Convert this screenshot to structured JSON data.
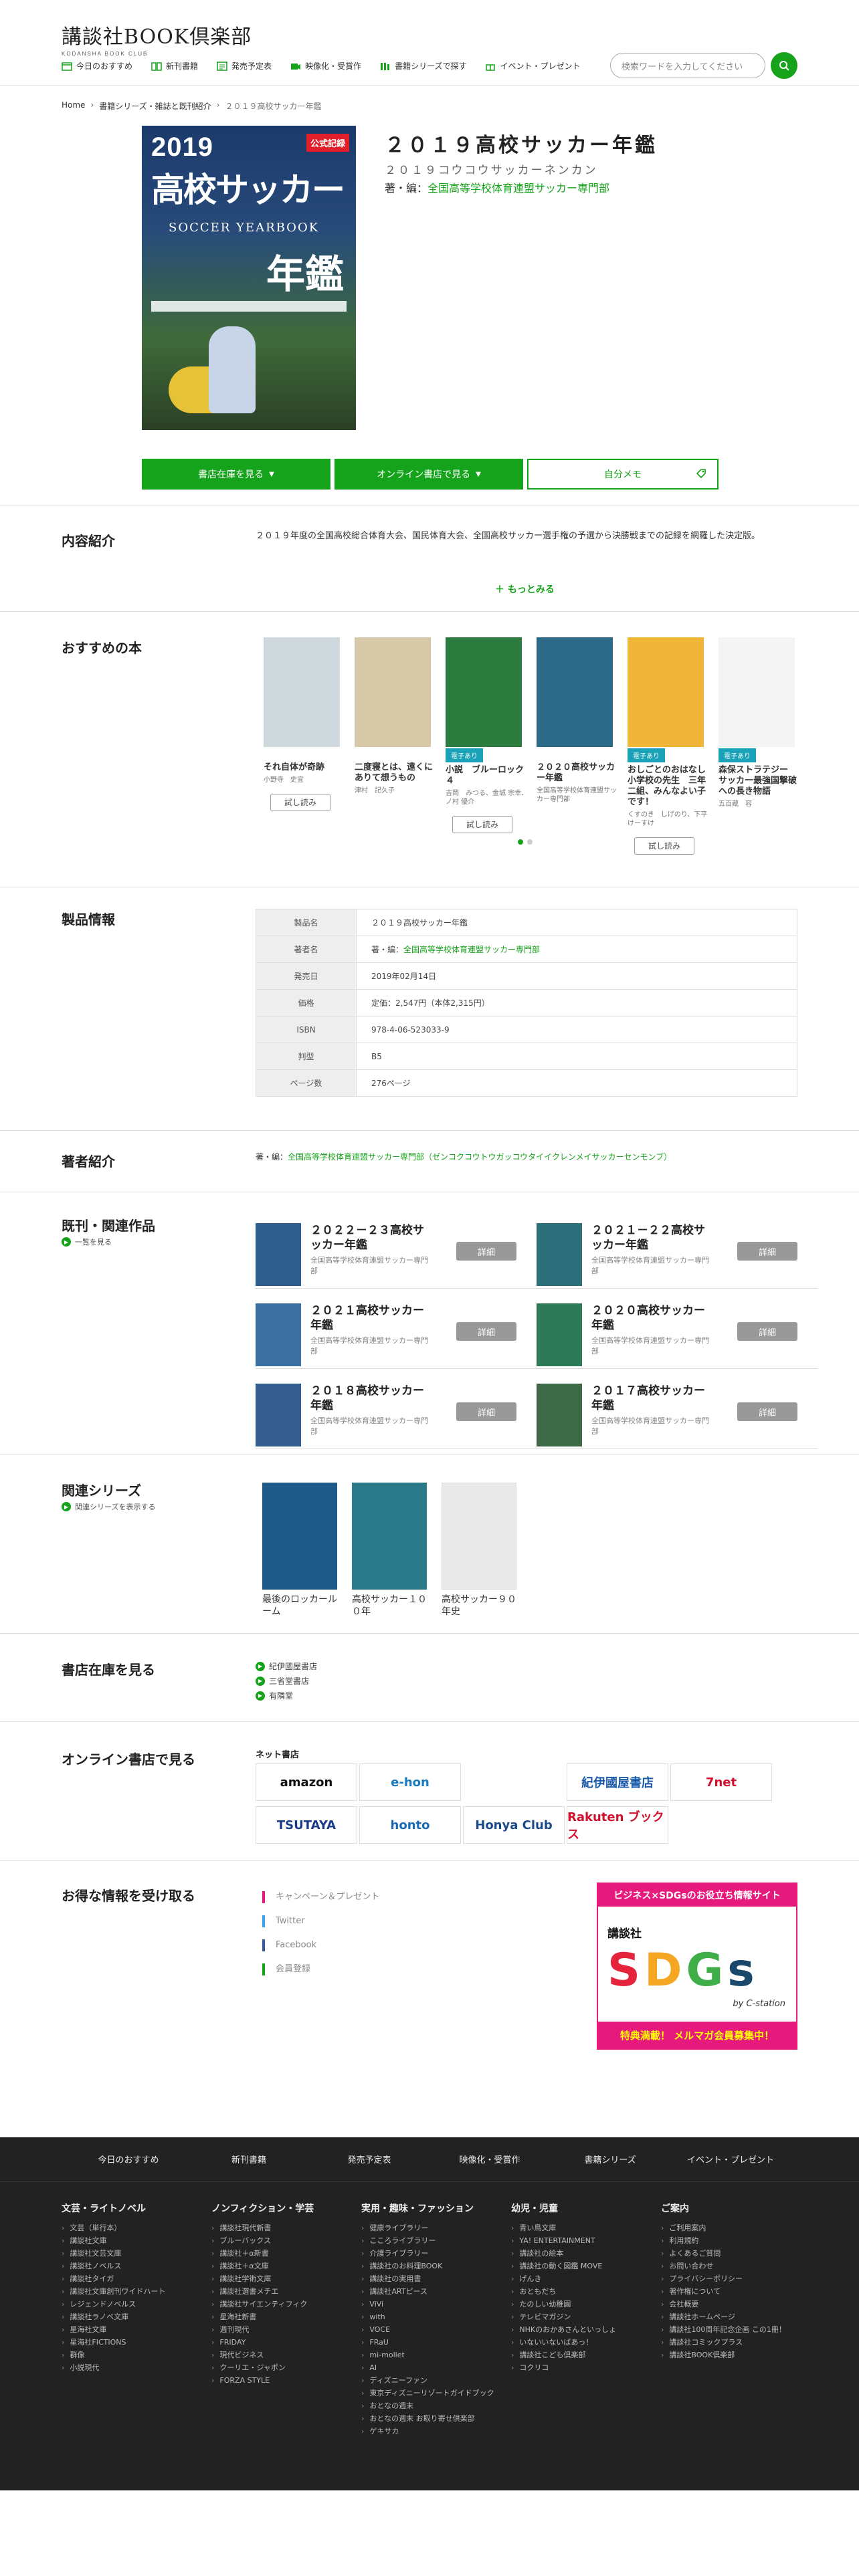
{
  "header": {
    "logo": "講談社BOOK倶楽部",
    "logo_sub": "KODANSHA BOOK CLUB",
    "nav": [
      "今日のおすすめ",
      "新刊書籍",
      "発売予定表",
      "映像化・受賞作",
      "書籍シリーズで探す",
      "イベント・プレゼント"
    ],
    "search_placeholder": "検索ワードを入力してください"
  },
  "breadcrumb": [
    "Home",
    "書籍シリーズ・雑誌と既刊紹介",
    "２０１９高校サッカー年鑑"
  ],
  "product": {
    "cover": {
      "year": "2019",
      "badge": "公式記録",
      "title1": "高校サッカー",
      "sub": "SOCCER YEARBOOK",
      "title2": "年鑑"
    },
    "title": "２０１９高校サッカー年鑑",
    "kana": "２０１９コウコウサッカーネンカン",
    "author_label": "著・編：",
    "author": "全国高等学校体育連盟サッカー専門部",
    "buttons": [
      "書店在庫を見る",
      "オンライン書店で見る",
      "自分メモ"
    ]
  },
  "intro": {
    "heading": "内容紹介",
    "text": "２０１９年度の全国高校総合体育大会、国民体育大会、全国高校サッカー選手権の予選から決勝戦までの記録を網羅した決定版。",
    "more": "＋ もっとみる"
  },
  "recommend": {
    "heading": "おすすめの本",
    "books": [
      {
        "name": "それ自体が奇跡",
        "author": "小野寺　史宜",
        "tag": "",
        "try": "試し読み",
        "color": "#cfd8dc"
      },
      {
        "name": "二度寝とは、遠くにありて想うもの",
        "author": "津村　記久子",
        "tag": "",
        "try": "",
        "color": "#d7c9a8"
      },
      {
        "name": "小説　ブルーロック　４",
        "author": "吉岡　みつる、金城 宗幸、ノ村 優介",
        "tag": "電子あり",
        "try": "試し読み",
        "color": "#2c7b3f"
      },
      {
        "name": "２０２０高校サッカー年鑑",
        "author": "全国高等学校体育連盟サッカー専門部",
        "tag": "",
        "try": "",
        "color": "#2d6a8a"
      },
      {
        "name": "おしごとのおはなし　小学校の先生　三年二組、みんなよい子です！",
        "author": "くすのき　しげのり、下平　けーすけ",
        "tag": "電子あり",
        "try": "試し読み",
        "color": "#f0b63a"
      },
      {
        "name": "森保ストラテジー　サッカー最強国撃破への長き物語",
        "author": "五百蔵　容",
        "tag": "電子あり",
        "try": "",
        "color": "#f4f4f4"
      }
    ]
  },
  "specs": {
    "heading": "製品情報",
    "rows": [
      {
        "k": "製品名",
        "v": "２０１９高校サッカー年鑑"
      },
      {
        "k": "著者名",
        "v": "著・編：",
        "link": "全国高等学校体育連盟サッカー専門部"
      },
      {
        "k": "発売日",
        "v": "2019年02月14日"
      },
      {
        "k": "価格",
        "v": "定価：2,547円（本体2,315円）"
      },
      {
        "k": "ISBN",
        "v": "978-4-06-523033-9"
      },
      {
        "k": "判型",
        "v": "B5"
      },
      {
        "k": "ページ数",
        "v": "276ページ"
      }
    ]
  },
  "author_sec": {
    "heading": "著者紹介",
    "label": "著・編：",
    "text": "全国高等学校体育連盟サッカー専門部（ゼンコクコウトウガッコウタイイクレンメイサッカーセンモンブ）"
  },
  "related": {
    "heading": "既刊・関連作品",
    "sub": "一覧を見る",
    "items": [
      {
        "name": "２０２２－２３高校サッカー年鑑",
        "author": "全国高等学校体育連盟サッカー専門部",
        "btn": "詳細"
      },
      {
        "name": "２０２１－２２高校サッカー年鑑",
        "author": "全国高等学校体育連盟サッカー専門部",
        "btn": "詳細"
      },
      {
        "name": "２０２１高校サッカー年鑑",
        "author": "全国高等学校体育連盟サッカー専門部",
        "btn": "詳細"
      },
      {
        "name": "２０２０高校サッカー年鑑",
        "author": "全国高等学校体育連盟サッカー専門部",
        "btn": "詳細"
      },
      {
        "name": "２０１８高校サッカー年鑑",
        "author": "全国高等学校体育連盟サッカー専門部",
        "btn": "詳細"
      },
      {
        "name": "２０１７高校サッカー年鑑",
        "author": "全国高等学校体育連盟サッカー専門部",
        "btn": "詳細"
      }
    ]
  },
  "series": {
    "heading": "関連シリーズ",
    "sub": "関連シリーズを表示する",
    "items": [
      {
        "name": "最後のロッカールーム",
        "color": "#1f5b8a"
      },
      {
        "name": "高校サッカー１００年",
        "color": "#2a7a8a"
      },
      {
        "name": "高校サッカー９０年史",
        "color": "#e9e9e9"
      }
    ]
  },
  "stock": {
    "heading": "書店在庫を見る",
    "stores": [
      "紀伊國屋書店",
      "三省堂書店",
      "有隣堂"
    ]
  },
  "online": {
    "heading": "オンライン書店で見る",
    "net": "ネット書店",
    "logos": [
      "amazon",
      "e-hon",
      "",
      "紀伊國屋書店",
      "7net",
      "TSUTAYA",
      "honto",
      "Honya Club",
      "Rakuten ブックス",
      ""
    ]
  },
  "info": {
    "heading": "お得な情報を受け取る",
    "links": [
      "キャンペーン＆プレゼント",
      "Twitter",
      "Facebook",
      "会員登録"
    ],
    "banner_top": "ビジネス×SDGsのお役立ち情報サイト",
    "banner_brand": "講談社",
    "banner_main": "SDGs",
    "banner_by": "by C-station",
    "banner_bottom": "特典満載！ メルマガ会員募集中！"
  },
  "footer": {
    "nav": [
      "今日のおすすめ",
      "新刊書籍",
      "発売予定表",
      "映像化・受賞作",
      "書籍シリーズ",
      "イベント・プレゼント"
    ],
    "cols": [
      {
        "h": "文芸・ライトノベル",
        "items": [
          "文芸（単行本）",
          "講談社文庫",
          "講談社文芸文庫",
          "講談社ノベルス",
          "講談社タイガ",
          "講談社文庫創刊ワイドハート",
          "レジェンドノベルス",
          "講談社ラノベ文庫",
          "星海社文庫",
          "星海社FICTIONS",
          "群像",
          "小説現代"
        ]
      },
      {
        "h": "ノンフィクション・学芸",
        "items": [
          "講談社現代新書",
          "ブルーバックス",
          "講談社＋α新書",
          "講談社＋α文庫",
          "講談社学術文庫",
          "講談社選書メチエ",
          "講談社サイエンティフィク",
          "星海社新書",
          "週刊現代",
          "FRIDAY",
          "現代ビジネス",
          "クーリエ・ジャポン",
          "FORZA STYLE"
        ]
      },
      {
        "h": "実用・趣味・ファッション",
        "items": [
          "健康ライブラリー",
          "こころライブラリー",
          "介護ライブラリー",
          "講談社のお料理BOOK",
          "講談社の実用書",
          "講談社ARTピース",
          "ViVi",
          "with",
          "VOCE",
          "FRaU",
          "mi-mollet",
          "AI",
          "ディズニーファン",
          "東京ディズニーリゾートガイドブック",
          "おとなの週末",
          "おとなの週末 お取り寄せ倶楽部",
          "ゲキサカ"
        ]
      },
      {
        "h": "幼児・児童",
        "items": [
          "青い鳥文庫",
          "YA! ENTERTAINMENT",
          "講談社の絵本",
          "講談社の動く図鑑 MOVE",
          "げんき",
          "おともだち",
          "たのしい幼稚園",
          "テレビマガジン",
          "NHKのおかあさんといっしょ",
          "いないいないばあっ！",
          "講談社こども倶楽部",
          "コクリコ"
        ]
      },
      {
        "h": "ご案内",
        "items": [
          "ご利用案内",
          "利用規約",
          "よくあるご質問",
          "お問い合わせ",
          "プライバシーポリシー",
          "著作権について",
          "会社概要",
          "講談社ホームページ",
          "講談社100周年記念企画 この1冊！",
          "講談社コミックプラス",
          "講談社BOOK倶楽部"
        ]
      }
    ]
  },
  "colors": {
    "accent": "#14a31a",
    "pink": "#e6197d",
    "footer": "#222222"
  }
}
